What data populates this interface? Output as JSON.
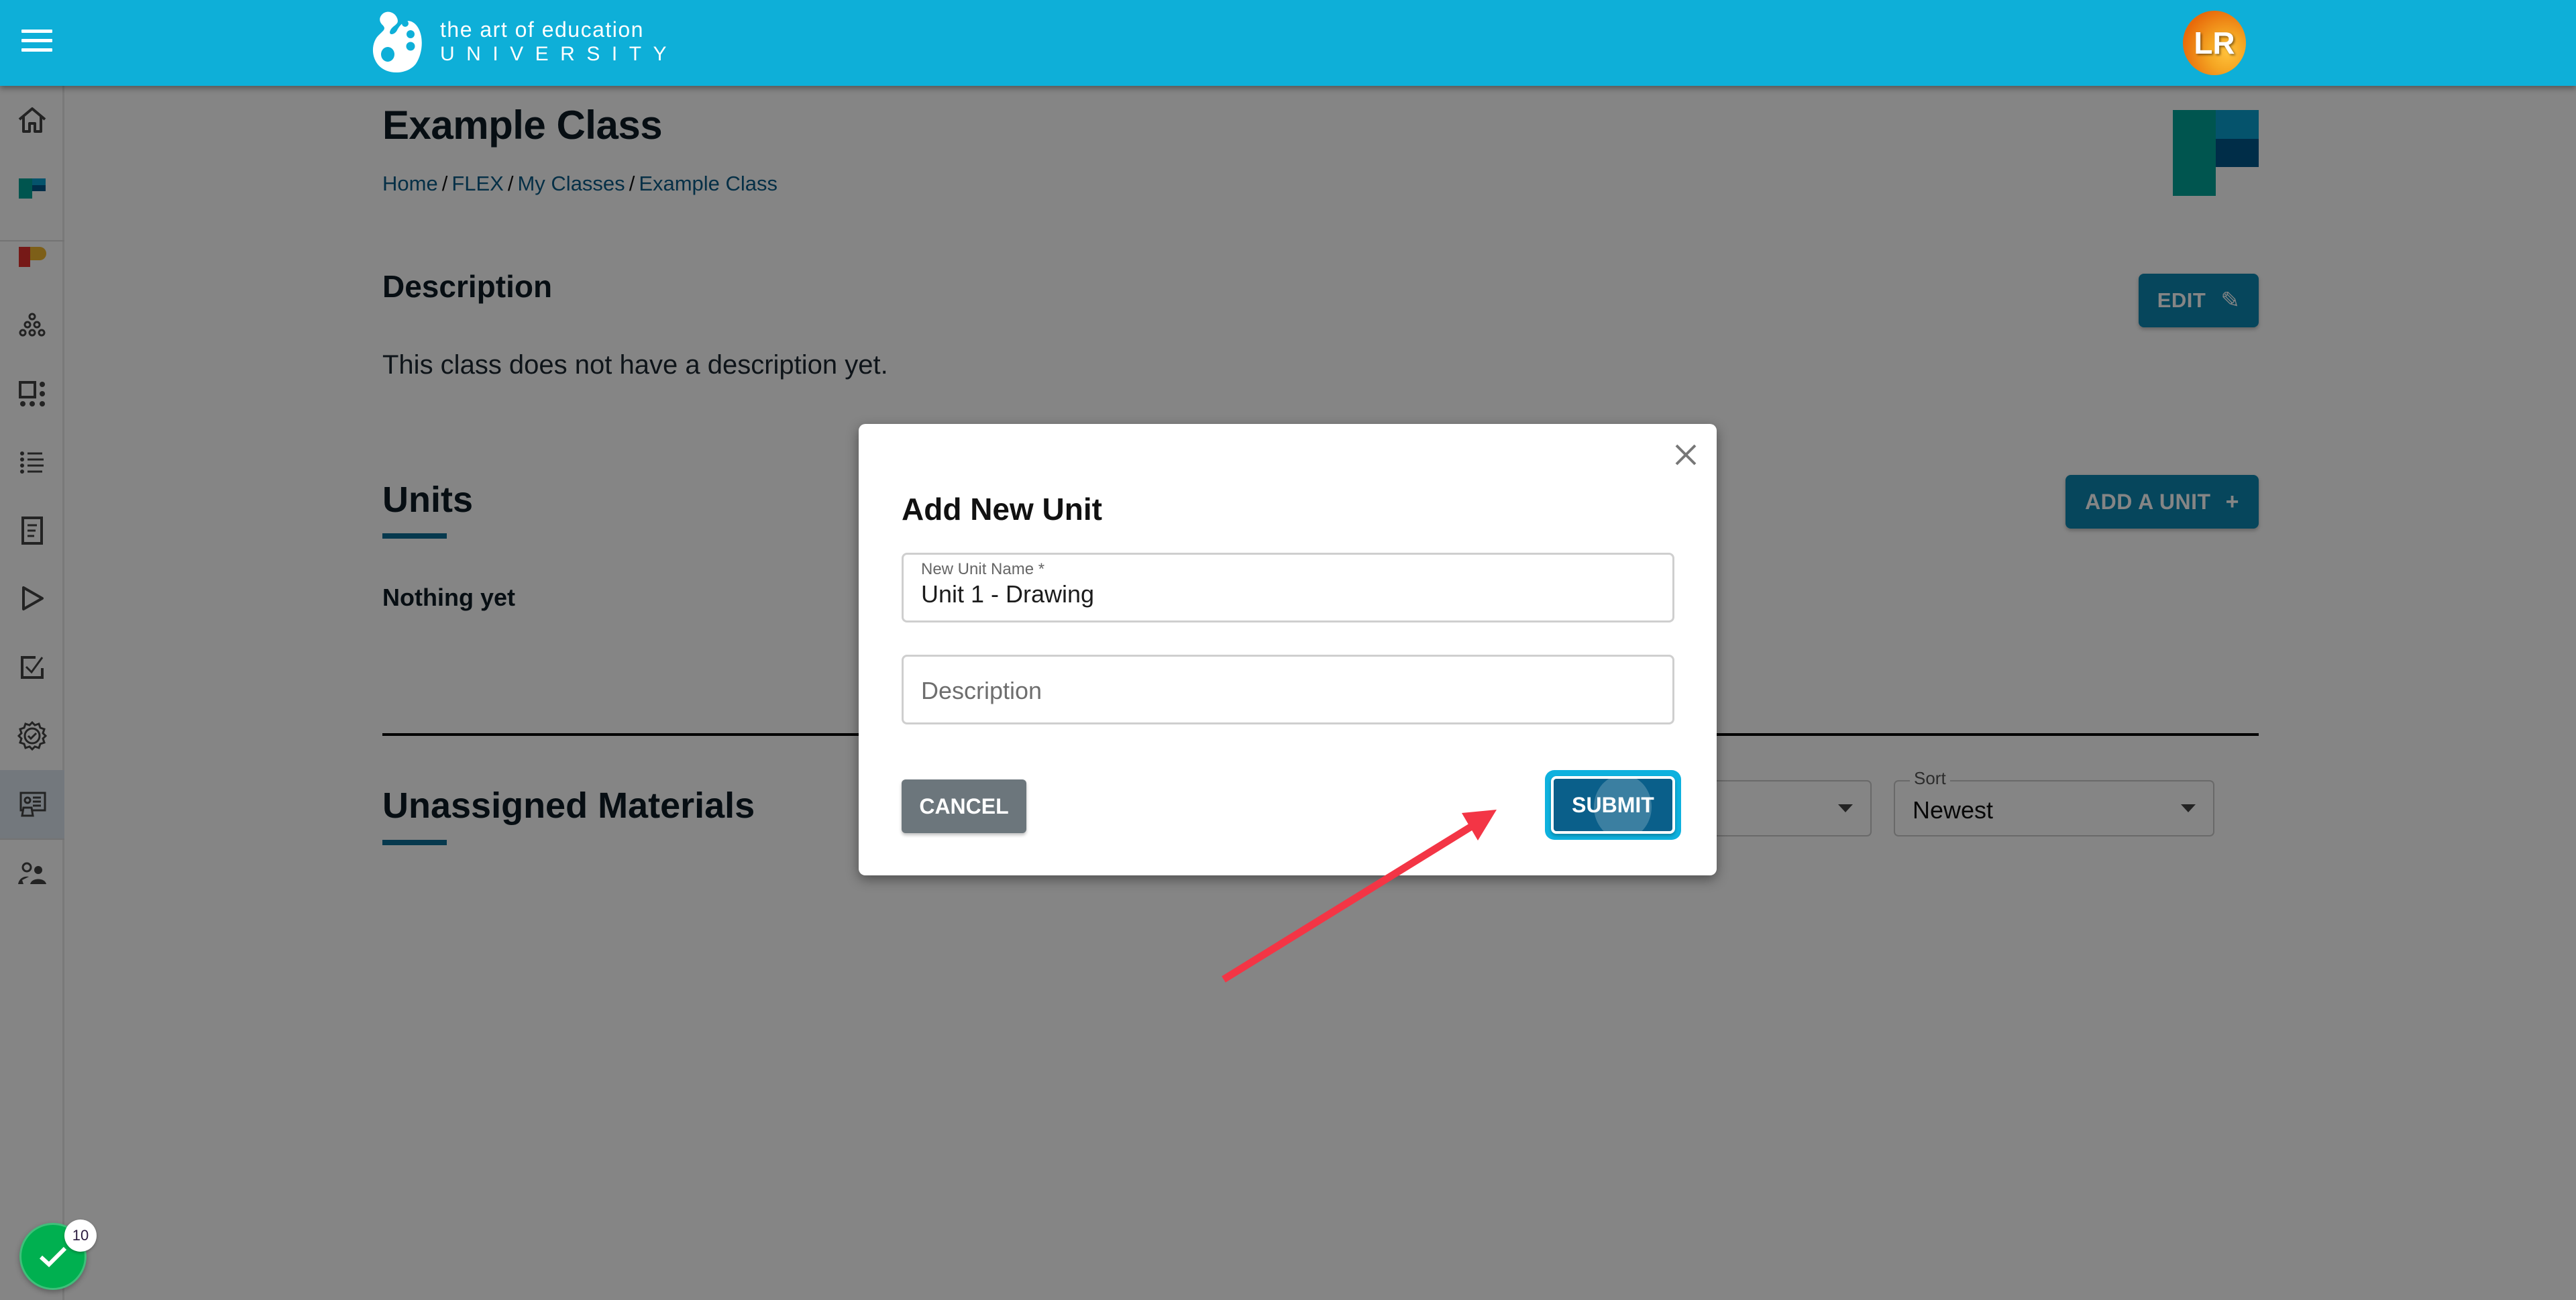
{
  "header": {
    "menu_icon": "hamburger-icon",
    "logo_line1": "the art of education",
    "logo_line2": "UNIVERSITY",
    "avatar_initials": "LR"
  },
  "sidebar": {
    "items": [
      {
        "name": "home",
        "icon": "home-icon",
        "active": false
      },
      {
        "name": "flex",
        "icon": "flex-logo-icon",
        "active": false
      },
      {
        "name": "pro",
        "icon": "pro-logo-icon",
        "active": false
      },
      {
        "name": "groups",
        "icon": "circles-icon",
        "active": false
      },
      {
        "name": "dashboard",
        "icon": "grid-dots-icon",
        "active": false
      },
      {
        "name": "list",
        "icon": "list-icon",
        "active": false
      },
      {
        "name": "document",
        "icon": "document-icon",
        "active": false
      },
      {
        "name": "play",
        "icon": "play-icon",
        "active": false
      },
      {
        "name": "checklist",
        "icon": "checkbox-icon",
        "active": false
      },
      {
        "name": "badges",
        "icon": "badge-check-icon",
        "active": false
      },
      {
        "name": "classes",
        "icon": "presentation-icon",
        "active": true
      },
      {
        "name": "users",
        "icon": "users-icon",
        "active": false
      }
    ]
  },
  "page": {
    "title": "Example Class",
    "breadcrumb": [
      {
        "label": "Home"
      },
      {
        "label": "FLEX"
      },
      {
        "label": "My Classes"
      },
      {
        "label": "Example Class"
      }
    ],
    "breadcrumb_separator": "/",
    "description": {
      "title": "Description",
      "text": "This class does not have a description yet.",
      "edit_label": "EDIT",
      "edit_icon": "pencil-icon"
    },
    "units": {
      "title": "Units",
      "empty_text": "Nothing yet",
      "add_label": "ADD A UNIT",
      "add_icon": "plus-icon"
    },
    "unassigned": {
      "title": "Unassigned Materials",
      "filter": {
        "value": ""
      },
      "sort": {
        "label": "Sort",
        "value": "Newest"
      }
    }
  },
  "fab": {
    "icon": "check-icon",
    "badge_count": "10"
  },
  "modal": {
    "title": "Add New Unit",
    "fields": {
      "name": {
        "label": "New Unit Name *",
        "value": "Unit 1 - Drawing"
      },
      "description": {
        "placeholder": "Description",
        "value": ""
      }
    },
    "cancel_label": "CANCEL",
    "submit_label": "SUBMIT",
    "close_icon": "close-icon"
  },
  "colors": {
    "header": "#0eafd8",
    "primary_button": "#0d86b0",
    "submit_focus_ring": "#0eb1de",
    "cancel_button": "#6c767c",
    "accent_underline": "#0c6d96",
    "annotation_arrow": "#f33545",
    "fab": "#00c15a"
  }
}
